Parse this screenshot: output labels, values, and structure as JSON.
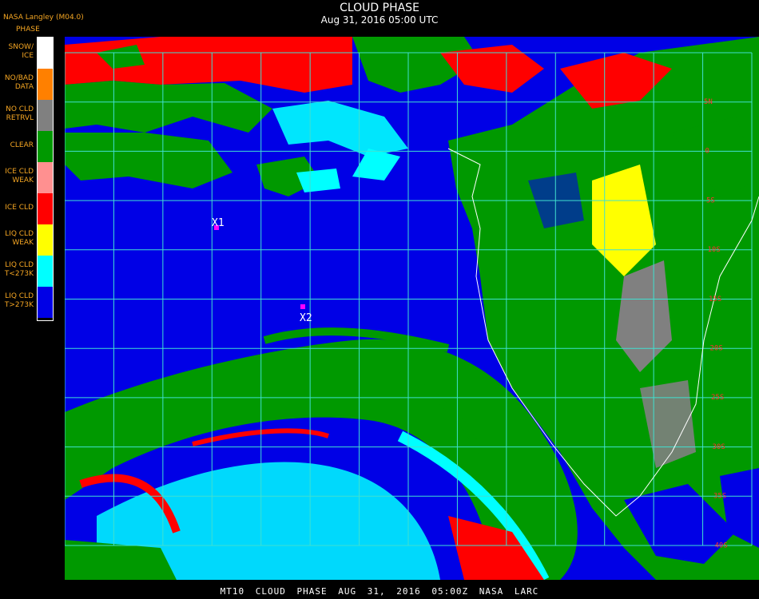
{
  "header": {
    "title": "CLOUD PHASE",
    "date": "Aug 31, 2016 05:00 UTC"
  },
  "org_label": "NASA Langley (M04.0)",
  "legend": {
    "heading": "PHASE",
    "items": [
      {
        "label": "SNOW/\nICE",
        "color": "#ffffff"
      },
      {
        "label": "NO/BAD\nDATA",
        "color": "#ff8000"
      },
      {
        "label": "NO CLD\nRETRVL",
        "color": "#808080"
      },
      {
        "label": "CLEAR",
        "color": "#009900"
      },
      {
        "label": "ICE CLD\nWEAK",
        "color": "#ff9090"
      },
      {
        "label": "ICE CLD",
        "color": "#ff0000"
      },
      {
        "label": "LIQ CLD\nWEAK",
        "color": "#ffff00"
      },
      {
        "label": "LIQ CLD\nT<273K",
        "color": "#00ffff"
      },
      {
        "label": "LIQ CLD\nT>273K",
        "color": "#0000e6"
      }
    ]
  },
  "markers": [
    {
      "label": "X1"
    },
    {
      "label": "X2"
    }
  ],
  "lat_labels": [
    "5N",
    "0",
    "5S",
    "10S",
    "15S",
    "20S",
    "25S",
    "30S",
    "35S",
    "40S"
  ],
  "footer": "MT10   CLOUD PHASE   AUG 31, 2016 05:00Z   NASA LARC",
  "colors": {
    "grid": "#40e0d0",
    "coast": "#ffffff",
    "marker": "#ff00ff",
    "lat_label": "#ff3030"
  }
}
